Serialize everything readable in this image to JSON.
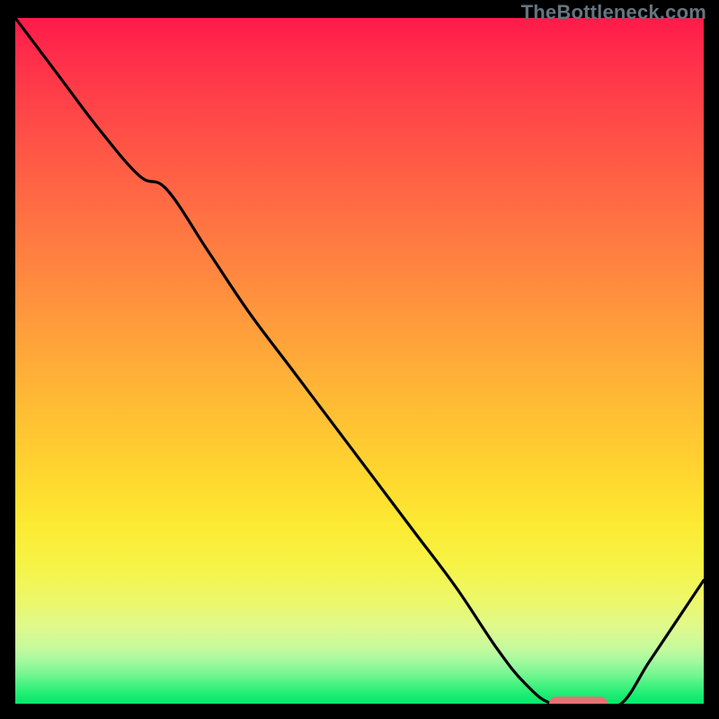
{
  "watermark": "TheBottleneck.com",
  "colors": {
    "frame": "#000000",
    "curve": "#000000",
    "marker": "#e57373",
    "gradient_top": "#ff1a4a",
    "gradient_bottom": "#06e96b"
  },
  "chart_data": {
    "type": "line",
    "title": "",
    "xlabel": "",
    "ylabel": "",
    "xlim": [
      0,
      100
    ],
    "ylim": [
      0,
      100
    ],
    "x": [
      0,
      6,
      12,
      18,
      22,
      28,
      34,
      40,
      46,
      52,
      58,
      64,
      70,
      74,
      78,
      84,
      88,
      92,
      96,
      100
    ],
    "values": [
      100,
      92,
      84,
      77,
      75,
      66,
      57,
      49,
      41,
      33,
      25,
      17,
      8,
      3,
      0,
      0,
      0,
      6,
      12,
      18
    ],
    "annotations": [
      {
        "kind": "marker",
        "x_start": 77.5,
        "x_end": 86,
        "y": 0
      }
    ]
  }
}
